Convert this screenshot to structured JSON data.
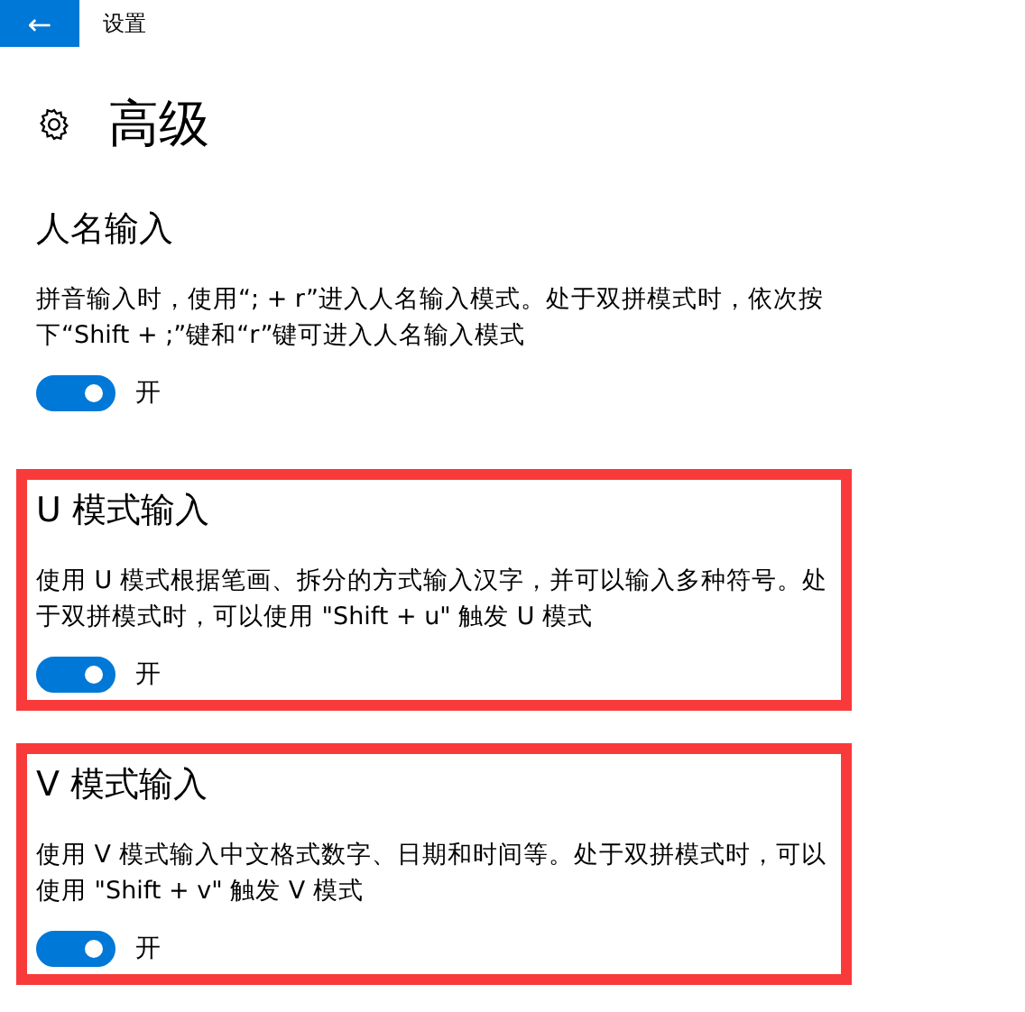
{
  "header": {
    "back": "←",
    "title": "设置"
  },
  "page": {
    "title": "高级"
  },
  "sections": [
    {
      "title": "人名输入",
      "description": "拼音输入时，使用“; + r”进入人名输入模式。处于双拼模式时，依次按下“Shift + ;”键和“r”键可进入人名输入模式",
      "toggle": {
        "on": true,
        "label": "开"
      },
      "highlighted": false
    },
    {
      "title": "U 模式输入",
      "description": "使用 U 模式根据笔画、拆分的方式输入汉字，并可以输入多种符号。处于双拼模式时，可以使用 \"Shift + u\" 触发 U 模式",
      "toggle": {
        "on": true,
        "label": "开"
      },
      "highlighted": true
    },
    {
      "title": "V 模式输入",
      "description": "使用 V 模式输入中文格式数字、日期和时间等。处于双拼模式时，可以使用 \"Shift + v\" 触发 V 模式",
      "toggle": {
        "on": true,
        "label": "开"
      },
      "highlighted": true
    }
  ]
}
